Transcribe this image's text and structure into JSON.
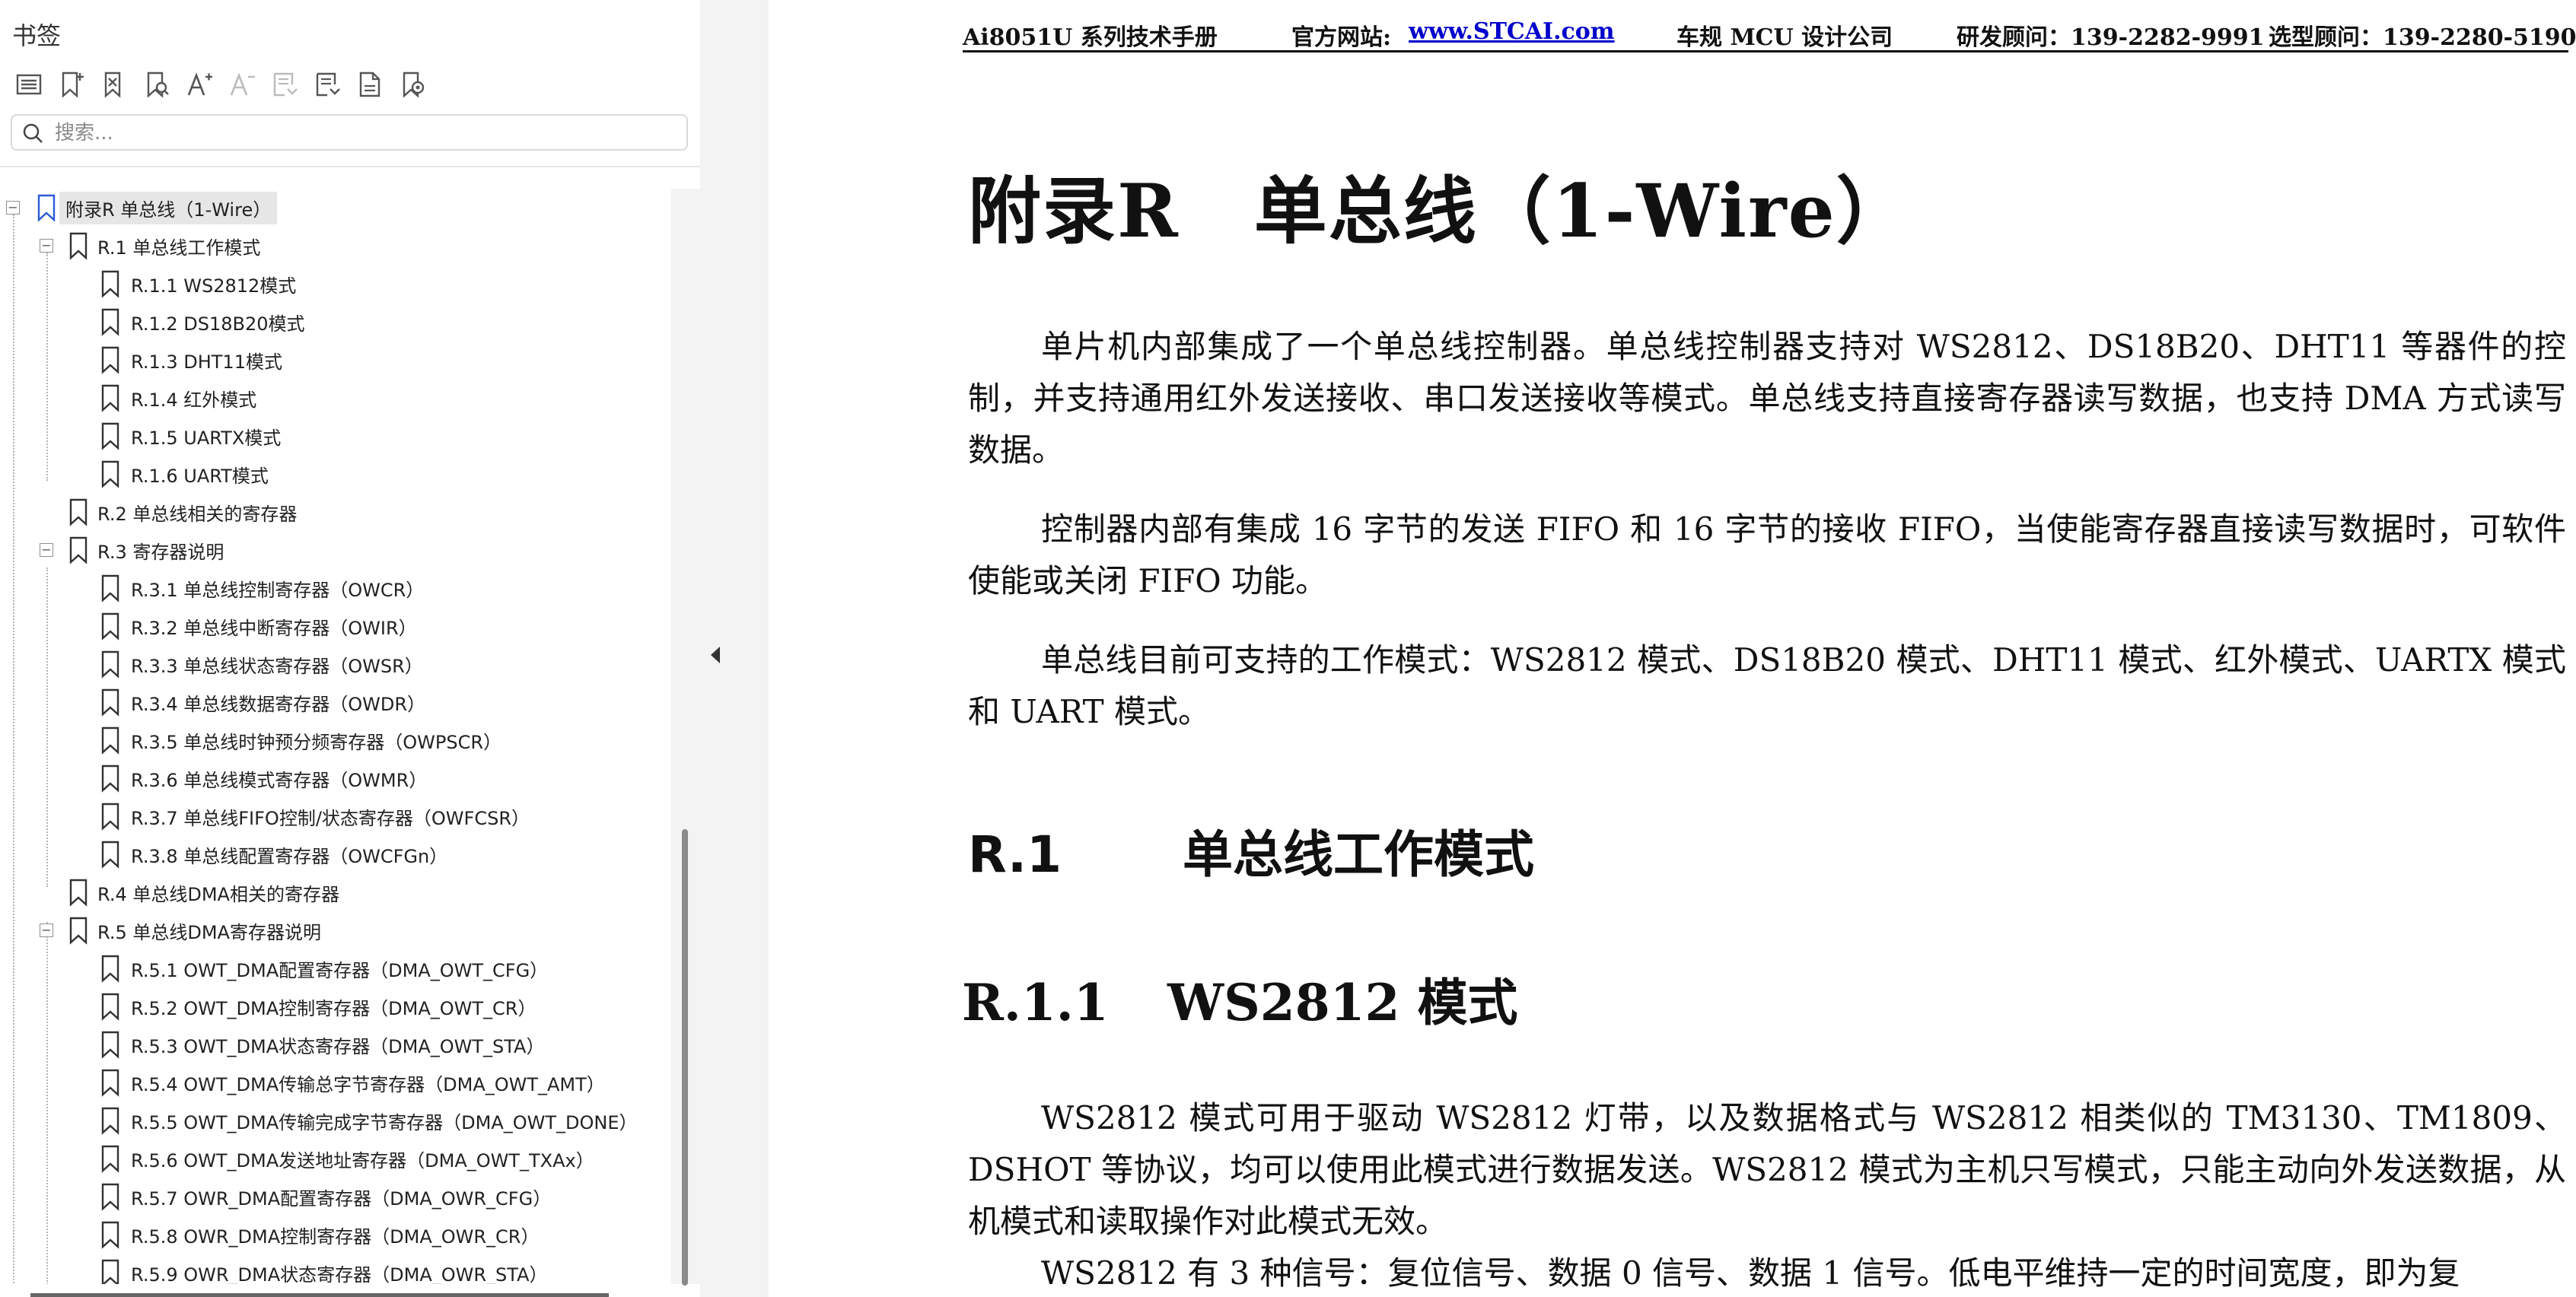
{
  "sidebar": {
    "title": "书签",
    "search_placeholder": "搜索...",
    "toolbar_icons": [
      "expand-all-icon",
      "add-bookmark-icon",
      "delete-bookmark-icon",
      "find-bookmark-icon",
      "font-larger-icon",
      "font-smaller-icon",
      "bookmark-properties-icon",
      "new-child-bookmark-icon",
      "bookmark-page-icon",
      "bookmark-settings-icon"
    ],
    "bookmarks": [
      {
        "label": "附录R  单总线（1-Wire）",
        "level": 0,
        "toggle": "−",
        "selected": true
      },
      {
        "label": "R.1 单总线工作模式",
        "level": 1,
        "toggle": "−"
      },
      {
        "label": "R.1.1 WS2812模式",
        "level": 2
      },
      {
        "label": "R.1.2 DS18B20模式",
        "level": 2
      },
      {
        "label": "R.1.3 DHT11模式",
        "level": 2
      },
      {
        "label": "R.1.4 红外模式",
        "level": 2
      },
      {
        "label": "R.1.5 UARTX模式",
        "level": 2
      },
      {
        "label": "R.1.6  UART模式",
        "level": 2
      },
      {
        "label": "R.2  单总线相关的寄存器",
        "level": 1
      },
      {
        "label": "R.3  寄存器说明",
        "level": 1,
        "toggle": "−"
      },
      {
        "label": "R.3.1 单总线控制寄存器（OWCR）",
        "level": 2
      },
      {
        "label": "R.3.2  单总线中断寄存器（OWIR）",
        "level": 2
      },
      {
        "label": "R.3.3 单总线状态寄存器（OWSR）",
        "level": 2
      },
      {
        "label": "R.3.4 单总线数据寄存器（OWDR）",
        "level": 2
      },
      {
        "label": "R.3.5 单总线时钟预分频寄存器（OWPSCR）",
        "level": 2
      },
      {
        "label": "R.3.6 单总线模式寄存器（OWMR）",
        "level": 2
      },
      {
        "label": "R.3.7  单总线FIFO控制/状态寄存器（OWFCSR）",
        "level": 2
      },
      {
        "label": "R.3.8 单总线配置寄存器（OWCFGn）",
        "level": 2
      },
      {
        "label": "R.4  单总线DMA相关的寄存器",
        "level": 1
      },
      {
        "label": "R.5  单总线DMA寄存器说明",
        "level": 1,
        "toggle": "−"
      },
      {
        "label": "R.5.1 OWT_DMA配置寄存器（DMA_OWT_CFG）",
        "level": 2
      },
      {
        "label": "R.5.2 OWT_DMA控制寄存器（DMA_OWT_CR）",
        "level": 2
      },
      {
        "label": "R.5.3 OWT_DMA状态寄存器（DMA_OWT_STA）",
        "level": 2
      },
      {
        "label": "R.5.4  OWT_DMA传输总字节寄存器（DMA_OWT_AMT）",
        "level": 2
      },
      {
        "label": "R.5.5 OWT_DMA传输完成字节寄存器（DMA_OWT_DONE）",
        "level": 2
      },
      {
        "label": "R.5.6 OWT_DMA发送地址寄存器（DMA_OWT_TXAx）",
        "level": 2
      },
      {
        "label": "R.5.7 OWR_DMA配置寄存器（DMA_OWR_CFG）",
        "level": 2
      },
      {
        "label": "R.5.8  OWR_DMA控制寄存器（DMA_OWR_CR）",
        "level": 2
      },
      {
        "label": "R.5.9 OWR_DMA状态寄存器（DMA_OWR_STA）",
        "level": 2
      }
    ]
  },
  "document": {
    "header": {
      "manual": "Ai8051U 系列技术手册",
      "site_label": "官方网站:",
      "site_link": "www.STCAI.com",
      "company": "车规 MCU 设计公司",
      "rd_contact": "研发顾问：139-2282-9991",
      "sel_contact": "选型顾问：139-2280-5190"
    },
    "title": "附录R　单总线（1-Wire）",
    "paragraphs": [
      "单片机内部集成了一个单总线控制器。单总线控制器支持对 WS2812、DS18B20、DHT11 等器件的控制，并支持通用红外发送接收、串口发送接收等模式。单总线支持直接寄存器读写数据，也支持 DMA 方式读写数据。",
      "控制器内部有集成 16 字节的发送 FIFO 和 16 字节的接收 FIFO，当使能寄存器直接读写数据时，可软件使能或关闭 FIFO 功能。",
      "单总线目前可支持的工作模式：WS2812 模式、DS18B20 模式、DHT11 模式、红外模式、UARTX 模式和 UART 模式。"
    ],
    "section": {
      "number": "R.1",
      "title": "单总线工作模式"
    },
    "subsection": {
      "number": "R.1.1",
      "title": "WS2812 模式"
    },
    "paragraphs2": [
      "WS2812 模式可用于驱动 WS2812 灯带，以及数据格式与 WS2812 相类似的 TM3130、TM1809、DSHOT 等协议，均可以使用此模式进行数据发送。WS2812 模式为主机只写模式，只能主动向外发送数据，从机模式和读取操作对此模式无效。",
      "WS2812 有 3 种信号：复位信号、数据 0 信号、数据 1 信号。低电平维持一定的时间宽度，即为复"
    ]
  }
}
